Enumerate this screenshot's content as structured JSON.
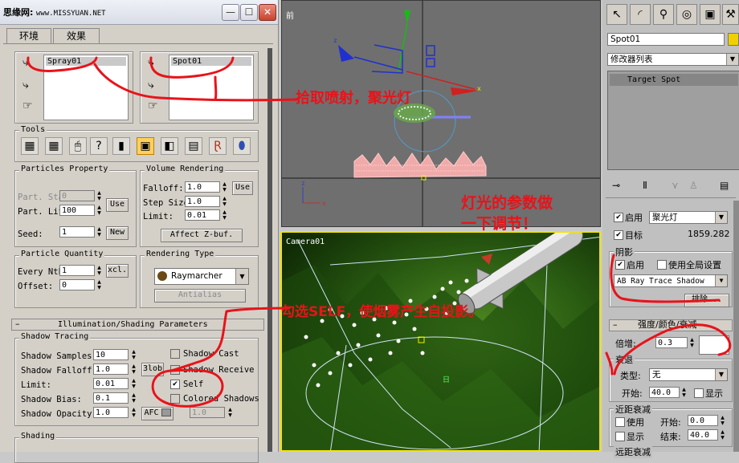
{
  "dialog": {
    "title_logo": "思缘网:",
    "title_url": "www.MISSYUAN.NET",
    "tabs": [
      "环境",
      "效果"
    ],
    "list_left_item": "Spray01",
    "list_right_item": "Spot01",
    "tools_label": "Tools",
    "particles_label": "Particles Property",
    "part_start_label": "Part. Start:",
    "part_start_value": "0",
    "part_life_label": "Part. Life:",
    "part_life_value": "100",
    "use_button": "Use",
    "seed_label": "Seed:",
    "seed_value": "1",
    "new_button": "New",
    "volume_label": "Volume Rendering",
    "falloff_label": "Falloff:",
    "falloff_value": "1.0",
    "use_button2": "Use",
    "step_label": "Step Size:",
    "step_value": "1.0",
    "limit_label": "Limit:",
    "limit_value": "0.01",
    "affect_zbuf": "Affect Z-buf.",
    "particle_qty_label": "Particle Quantity",
    "every_nth_label": "Every Nth:",
    "every_nth_value": "1",
    "excl_button": "xcl.",
    "offset_label": "Offset:",
    "offset_value": "0",
    "rendering_type_label": "Rendering Type",
    "renderer": "Raymarcher",
    "antialias": "Antialias",
    "illum_rollout": "Illumination/Shading Parameters",
    "shadow_tracing_label": "Shadow Tracing",
    "shadow_samples_label": "Shadow Samples:",
    "shadow_samples_value": "10",
    "shadow_falloff_label": "Shadow Falloff:",
    "shadow_falloff_value": "1.0",
    "glob_button": "3lob",
    "limit2_label": "Limit:",
    "limit2_value": "0.01",
    "shadow_bias_label": "Shadow Bias:",
    "shadow_bias_value": "0.1",
    "shadow_opacity_label": "Shadow Opacity:",
    "shadow_opacity_value": "1.0",
    "afc_button": "AFC",
    "afc_value": "1.0",
    "shadow_cast": "Shadow Cast",
    "shadow_receive": "Shadow Receive",
    "self": "Self",
    "colored_shadows": "Colored Shadows",
    "shading_label": "Shading"
  },
  "viewports": {
    "top_label": "前",
    "camera_label": "Camera01"
  },
  "command_panel": {
    "object_name": "Spot01",
    "modifier_list": "修改器列表",
    "stack_item": "Target Spot",
    "enable_label": "启用",
    "light_type": "聚光灯",
    "target_label": "目标",
    "target_value": "1859.282",
    "shadows_group": "阴影",
    "shadow_enable": "启用",
    "global_settings": "使用全局设置",
    "shadow_type": "AB Ray Trace Shadow",
    "exclude_button": "排除...",
    "intensity_rollout": "强度/颜色/衰减",
    "multiplier_label": "倍增:",
    "multiplier_value": "0.3",
    "decay_label": "衰退",
    "decay_type_label": "类型:",
    "decay_type": "无",
    "decay_start_label": "开始:",
    "decay_start_value": "40.0",
    "show_label": "显示",
    "near_atten_label": "近距衰减",
    "near_use": "使用",
    "near_start_label": "开始:",
    "near_start_value": "0.0",
    "near_show": "显示",
    "near_end_label": "结束:",
    "near_end_value": "40.0",
    "far_atten_label": "远距衰减"
  },
  "annotations": {
    "pick": "拾取喷射，聚光灯",
    "adjust_line1": "灯光的参数做",
    "adjust_line2": "一下调节！",
    "self_note": "勾选SELF，使烟雾产生自投影。"
  },
  "colors": {
    "annotation_red": "#e8131a",
    "viewport_highlight": "#f4e300"
  }
}
